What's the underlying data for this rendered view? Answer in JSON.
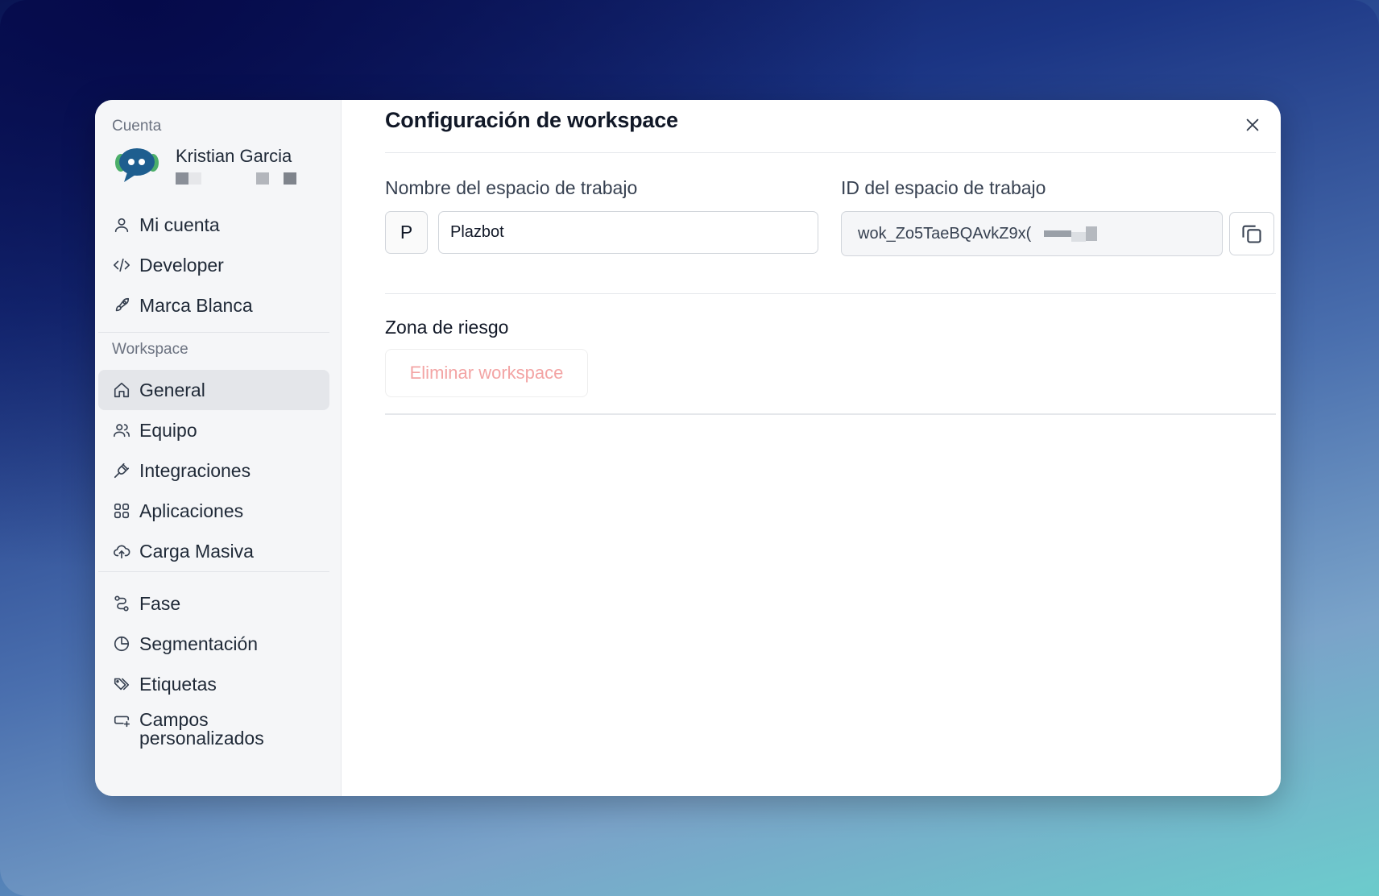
{
  "sidebar": {
    "account_section_label": "Cuenta",
    "account": {
      "name": "Kristian Garcia"
    },
    "account_items": [
      {
        "label": "Mi cuenta",
        "icon": "user-icon"
      },
      {
        "label": "Developer",
        "icon": "code-icon"
      },
      {
        "label": "Marca Blanca",
        "icon": "rocket-icon"
      }
    ],
    "workspace_section_label": "Workspace",
    "workspace_items": [
      {
        "label": "General",
        "icon": "home-icon",
        "active": true
      },
      {
        "label": "Equipo",
        "icon": "users-icon"
      },
      {
        "label": "Integraciones",
        "icon": "plug-icon"
      },
      {
        "label": "Aplicaciones",
        "icon": "grid-icon"
      },
      {
        "label": "Carga Masiva",
        "icon": "cloud-upload-icon"
      }
    ],
    "extra_items": [
      {
        "label": "Fase",
        "icon": "route-icon"
      },
      {
        "label": "Segmentación",
        "icon": "pie-chart-icon"
      },
      {
        "label": "Etiquetas",
        "icon": "tags-icon"
      },
      {
        "label": "Campos personalizados",
        "label_line1": "Campos",
        "label_line2": "personalizados",
        "icon": "custom-field-icon"
      }
    ]
  },
  "main": {
    "title": "Configuración de workspace",
    "name_field": {
      "label": "Nombre del espacio de trabajo",
      "initial": "P",
      "value": "Plazbot"
    },
    "id_field": {
      "label": "ID del espacio de trabajo",
      "value": "wok_Zo5TaeBQAvkZ9x("
    },
    "danger_zone": {
      "label": "Zona de riesgo",
      "button": "Eliminar workspace"
    }
  },
  "colors": {
    "danger_text": "#f3a4a4",
    "active_nav_bg": "#e4e6ea",
    "sidebar_bg": "#f5f6f8"
  }
}
